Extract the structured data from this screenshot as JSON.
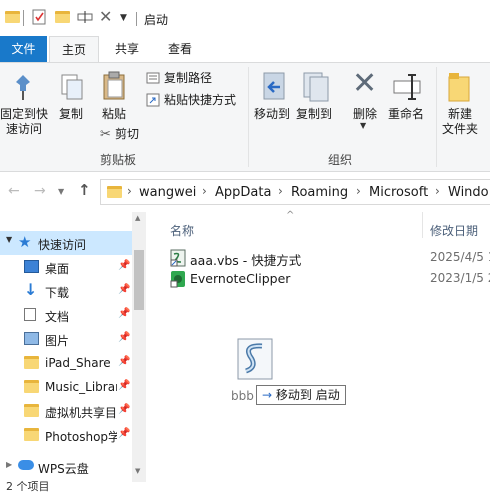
{
  "window": {
    "title": "启动"
  },
  "ribbon_tabs": {
    "file": "文件",
    "home": "主页",
    "share": "共享",
    "view": "查看"
  },
  "clipboard": {
    "pin": "固定到快\n速访问",
    "copy": "复制",
    "paste": "粘贴",
    "copy_path": "复制路径",
    "paste_shortcut": "粘贴快捷方式",
    "cut": "剪切",
    "group": "剪贴板"
  },
  "organize": {
    "move_to": "移动到",
    "copy_to": "复制到",
    "delete": "删除",
    "rename": "重命名",
    "group": "组织"
  },
  "new": {
    "new_folder": "新建\n文件夹"
  },
  "address": {
    "crumbs": [
      "wangwei",
      "AppData",
      "Roaming",
      "Microsoft",
      "Window"
    ]
  },
  "nav": {
    "items": [
      {
        "label": "快速访问"
      },
      {
        "label": "桌面"
      },
      {
        "label": "下载"
      },
      {
        "label": "文档"
      },
      {
        "label": "图片"
      },
      {
        "label": "iPad_Share"
      },
      {
        "label": "Music_Librar"
      },
      {
        "label": "虚拟机共享目"
      },
      {
        "label": "Photoshop学"
      },
      {
        "label": "WPS云盘"
      }
    ]
  },
  "columns": {
    "name": "名称",
    "modified": "修改日期"
  },
  "files": [
    {
      "name": "aaa.vbs - 快捷方式",
      "date": "2025/4/5 1"
    },
    {
      "name": "EvernoteClipper",
      "date": "2023/1/5 2"
    }
  ],
  "drag": {
    "label": "bbb",
    "tip_arrow": "→",
    "tip_text": "移动到 启动"
  },
  "status": {
    "count": "2 个项目"
  }
}
